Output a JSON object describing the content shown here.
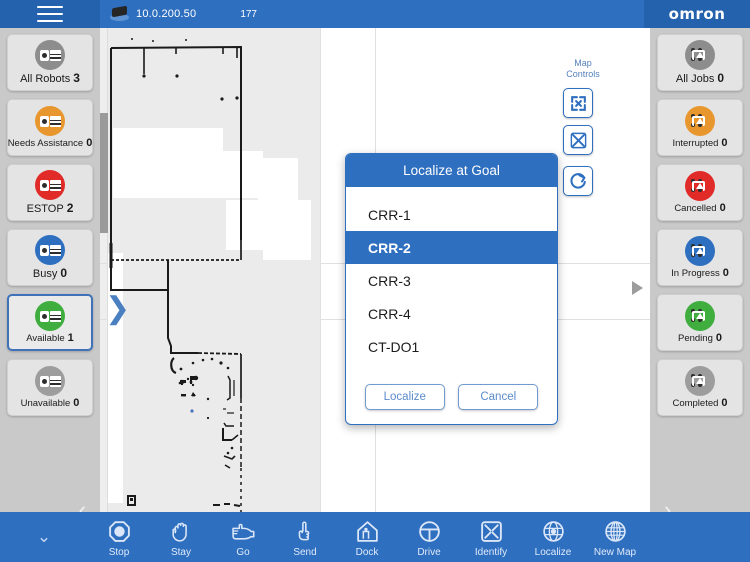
{
  "header": {
    "menu_icon": "hamburger-icon",
    "robot_icon": "robot-icon",
    "ip_address": "10.0.200.50",
    "number": "177",
    "brand": "omron"
  },
  "left_sidebar": {
    "items": [
      {
        "label": "All Robots",
        "count": "3",
        "color": "#8d8d8d",
        "icon": "robot-icon",
        "selected": false,
        "size": "big"
      },
      {
        "label": "Needs Assistance",
        "count": "0",
        "color": "#e8972e",
        "icon": "robot-icon",
        "selected": false,
        "size": "small"
      },
      {
        "label": "ESTOP",
        "count": "2",
        "color": "#e02b28",
        "icon": "robot-icon",
        "selected": false,
        "size": "big"
      },
      {
        "label": "Busy",
        "count": "0",
        "color": "#2f6fc0",
        "icon": "robot-icon",
        "selected": false,
        "size": "big"
      },
      {
        "label": "Available",
        "count": "1",
        "color": "#3fae3f",
        "icon": "robot-icon",
        "selected": true,
        "size": "small"
      },
      {
        "label": "Unavailable",
        "count": "0",
        "color": "#9d9d9d",
        "icon": "robot-icon",
        "selected": false,
        "size": "small"
      }
    ],
    "collapse_icon": "chevron-left-icon"
  },
  "right_sidebar": {
    "items": [
      {
        "label": "All Jobs",
        "count": "0",
        "color": "#8d8d8d",
        "icon": "job-icon",
        "selected": false,
        "size": "big"
      },
      {
        "label": "Interrupted",
        "count": "0",
        "color": "#e8972e",
        "icon": "job-icon",
        "selected": false,
        "size": "small"
      },
      {
        "label": "Cancelled",
        "count": "0",
        "color": "#e02b28",
        "icon": "job-icon",
        "selected": false,
        "size": "small"
      },
      {
        "label": "In Progress",
        "count": "0",
        "color": "#2f6fc0",
        "icon": "job-icon",
        "selected": false,
        "size": "small"
      },
      {
        "label": "Pending",
        "count": "0",
        "color": "#3fae3f",
        "icon": "job-icon",
        "selected": false,
        "size": "small"
      },
      {
        "label": "Completed",
        "count": "0",
        "color": "#9d9d9d",
        "icon": "job-icon",
        "selected": false,
        "size": "small"
      }
    ],
    "collapse_icon": "chevron-right-icon"
  },
  "map": {
    "controls_label_line1": "Map",
    "controls_label_line2": "Controls",
    "controls": [
      {
        "name": "zoom-out-fullscreen-icon"
      },
      {
        "name": "zoom-in-fit-icon"
      },
      {
        "name": "refresh-icon"
      }
    ],
    "panel_chevron": "chevron-right-icon",
    "pan_arrow": "arrow-right-icon"
  },
  "modal": {
    "title": "Localize at Goal",
    "items": [
      {
        "label": "CRR-1",
        "selected": false
      },
      {
        "label": "CRR-2",
        "selected": true
      },
      {
        "label": "CRR-3",
        "selected": false
      },
      {
        "label": "CRR-4",
        "selected": false
      },
      {
        "label": "CT-DO1",
        "selected": false
      }
    ],
    "confirm_label": "Localize",
    "cancel_label": "Cancel"
  },
  "bottom_bar": {
    "collapse_icon": "chevron-down-icon",
    "items": [
      {
        "label": "Stop",
        "icon": "octagon-stop-icon"
      },
      {
        "label": "Stay",
        "icon": "hand-icon"
      },
      {
        "label": "Go",
        "icon": "pointing-hand-icon"
      },
      {
        "label": "Send",
        "icon": "pointing-up-hand-icon"
      },
      {
        "label": "Dock",
        "icon": "home-dock-icon"
      },
      {
        "label": "Drive",
        "icon": "steering-wheel-icon"
      },
      {
        "label": "Identify",
        "icon": "crosshair-square-icon"
      },
      {
        "label": "Localize",
        "icon": "globe-target-icon"
      },
      {
        "label": "New Map",
        "icon": "globe-icon"
      }
    ]
  },
  "colors": {
    "brand_blue": "#2f6fc0",
    "brand_blue_dark": "#2462ad",
    "sidebar_gray": "#c9c9c9",
    "card_gray": "#e4e4e4"
  }
}
